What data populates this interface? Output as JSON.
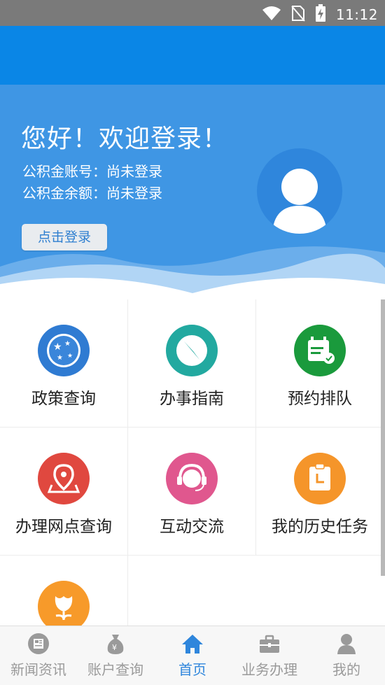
{
  "status_bar": {
    "time": "11:12",
    "icons": [
      "wifi-icon",
      "no-sim-icon",
      "battery-charging-icon"
    ]
  },
  "hero": {
    "greeting": "您好！欢迎登录！",
    "account_line": "公积金账号：尚未登录",
    "balance_line": "公积金余额：尚未登录",
    "login_button": "点击登录",
    "avatar_icon": "user-avatar-icon"
  },
  "grid": {
    "items": [
      {
        "label": "政策查询",
        "icon": "stars-globe-icon",
        "color": "#2f7bd2"
      },
      {
        "label": "办事指南",
        "icon": "compass-icon",
        "color": "#22a9a0"
      },
      {
        "label": "预约排队",
        "icon": "calendar-check-icon",
        "color": "#1a9a3c"
      },
      {
        "label": "办理网点查询",
        "icon": "map-pin-icon",
        "color": "#e0483f"
      },
      {
        "label": "互动交流",
        "icon": "headset-service-icon",
        "color": "#e0578e"
      },
      {
        "label": "我的历史任务",
        "icon": "clipboard-clock-icon",
        "color": "#f5952a"
      },
      {
        "label": "",
        "icon": "tulip-icon",
        "color": "#f79a2a"
      }
    ]
  },
  "bottom_nav": {
    "items": [
      {
        "label": "新闻资讯",
        "icon": "news-icon",
        "active": false
      },
      {
        "label": "账户查询",
        "icon": "money-bag-icon",
        "active": false
      },
      {
        "label": "首页",
        "icon": "home-icon",
        "active": true
      },
      {
        "label": "业务办理",
        "icon": "briefcase-icon",
        "active": false
      },
      {
        "label": "我的",
        "icon": "person-icon",
        "active": false
      }
    ]
  },
  "colors": {
    "app_bar": "#0a86e6",
    "hero": "#3f96e4",
    "accent": "#2f86dc",
    "inactive": "#9a9a9a"
  }
}
